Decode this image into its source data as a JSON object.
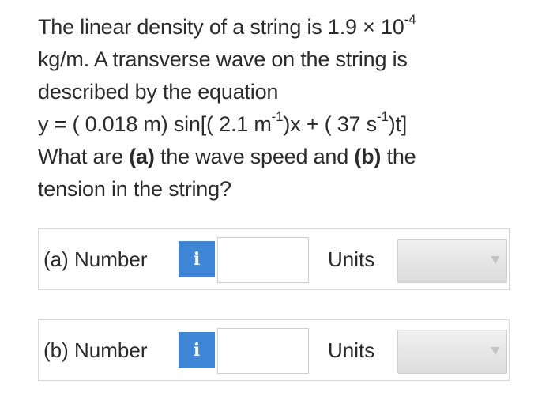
{
  "question": {
    "line1_text": "The linear density of a string is 1.9 × 10",
    "line1_exp": "-4",
    "line2": "kg/m. A transverse wave on the string is",
    "line3": "described by the equation",
    "eq_part1": "y = ( 0.018 m) sin[( 2.1 m",
    "eq_exp1": "-1",
    "eq_part2": ")x + ( 37 s",
    "eq_exp2": "-1",
    "eq_part3": ")t]",
    "line5_prefix": "What are ",
    "part_a": "(a)",
    "line5_middle": " the wave speed and ",
    "part_b": "(b)",
    "line5_suffix": " the",
    "line6": "tension in the string?"
  },
  "answers": [
    {
      "label": "(a) Number",
      "info_icon": "i",
      "value": "",
      "placeholder": "",
      "units_label": "Units",
      "units_value": ""
    },
    {
      "label": "(b) Number",
      "info_icon": "i",
      "value": "",
      "placeholder": "",
      "units_label": "Units",
      "units_value": ""
    }
  ],
  "colors": {
    "info_button": "#3f86d6",
    "text": "#2b2b2b",
    "border": "#d6d6d6"
  }
}
